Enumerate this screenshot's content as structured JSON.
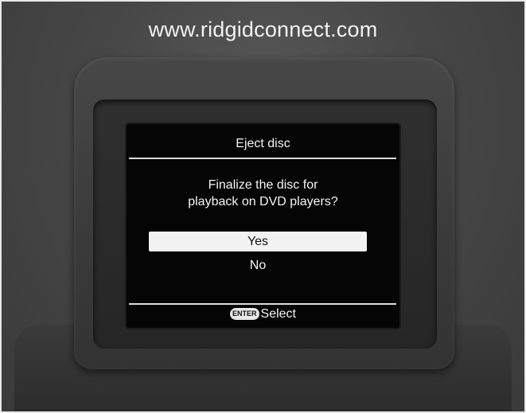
{
  "watermark": "www.ridgidconnect.com",
  "dialog": {
    "title": "Eject disc",
    "prompt_line1": "Finalize the disc for",
    "prompt_line2": "playback on DVD players?",
    "options": [
      {
        "label": "Yes",
        "selected": true
      },
      {
        "label": "No",
        "selected": false
      }
    ]
  },
  "footer": {
    "key_label": "ENTER",
    "action_label": "Select"
  },
  "colors": {
    "screen_bg": "#050505",
    "selected_bg": "#f2f2f2",
    "text": "#f4f4f4"
  }
}
